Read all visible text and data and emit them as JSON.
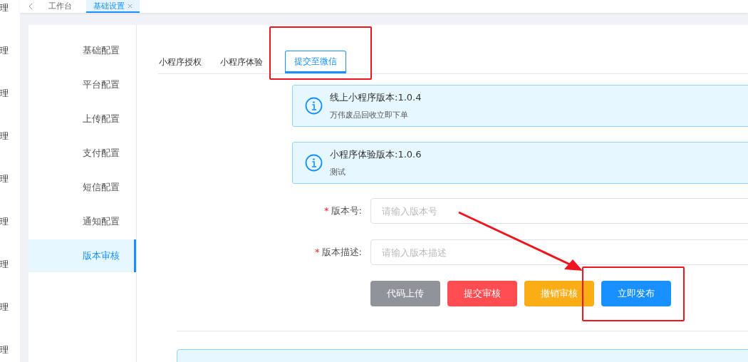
{
  "side_nav": {
    "items": [
      "理",
      "理",
      "理",
      "理",
      "理",
      "理",
      "理",
      "理",
      "理"
    ]
  },
  "top_tabs": [
    {
      "label": "工作台",
      "selected": false,
      "closable": false
    },
    {
      "label": "基础设置",
      "selected": true,
      "closable": true
    }
  ],
  "settings_menu": {
    "items": [
      {
        "label": "基础配置",
        "selected": false
      },
      {
        "label": "平台配置",
        "selected": false
      },
      {
        "label": "上传配置",
        "selected": false
      },
      {
        "label": "支付配置",
        "selected": false
      },
      {
        "label": "短信配置",
        "selected": false
      },
      {
        "label": "通知配置",
        "selected": false
      },
      {
        "label": "版本审核",
        "selected": true
      }
    ]
  },
  "tabs": [
    {
      "label": "小程序授权",
      "selected": false
    },
    {
      "label": "小程序体验",
      "selected": false
    },
    {
      "label": "提交至微信",
      "selected": true
    }
  ],
  "alerts": [
    {
      "title": "线上小程序版本:1.0.4",
      "description": "万伟废品回收立即下单"
    },
    {
      "title": "小程序体验版本:1.0.6",
      "description": "测试"
    }
  ],
  "form": [
    {
      "label": "版本号:",
      "required_mark": "*",
      "placeholder": "请输入版本号"
    },
    {
      "label": "版本描述:",
      "required_mark": "*",
      "placeholder": "请输入版本描述"
    }
  ],
  "buttons": [
    {
      "label": "代码上传",
      "color": "#909399"
    },
    {
      "label": "提交审核",
      "color": "#ff4d51"
    },
    {
      "label": "撤销审核",
      "color": "#faad14"
    },
    {
      "label": "立即发布",
      "color": "#1890ff"
    }
  ]
}
